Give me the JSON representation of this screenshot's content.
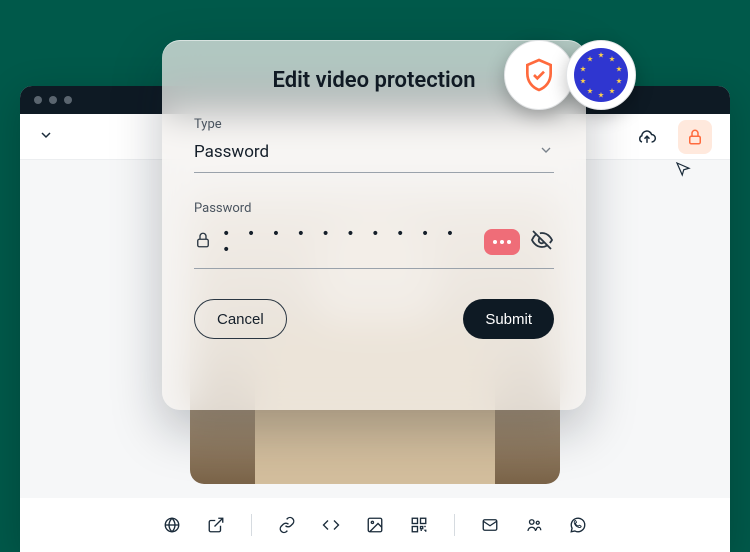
{
  "modal": {
    "title": "Edit video protection",
    "type_label": "Type",
    "type_value": "Password",
    "password_label": "Password",
    "password_masked": "• • • • • • • • • • •",
    "cancel_label": "Cancel",
    "submit_label": "Submit"
  },
  "badges": {
    "shield": "shield-verified",
    "eu": "eu-flag"
  },
  "topbar": {
    "chevron": "chevron-down",
    "upload": "cloud-upload",
    "lock": "lock"
  },
  "toolbar": {
    "items": [
      "globe",
      "external-link",
      "link",
      "code",
      "image",
      "qr",
      "mail",
      "teams",
      "whatsapp"
    ]
  }
}
